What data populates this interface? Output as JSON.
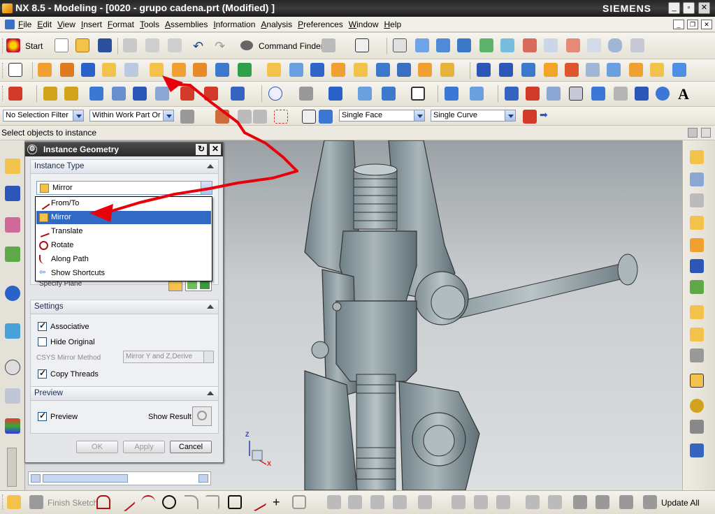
{
  "window": {
    "title": "NX 8.5 - Modeling - [0020 - grupo cadena.prt (Modified) ]",
    "brand": "SIEMENS",
    "controls": [
      "_",
      "▫",
      "✕"
    ]
  },
  "menu": [
    "File",
    "Edit",
    "View",
    "Insert",
    "Format",
    "Tools",
    "Assemblies",
    "Information",
    "Analysis",
    "Preferences",
    "Window",
    "Help"
  ],
  "toolbar1": {
    "start_label": "Start",
    "command_finder_label": "Command Finder"
  },
  "selection_bar": {
    "filter": "No Selection Filter",
    "scope": "Within Work Part Or",
    "face_rule": "Single Face",
    "curve_rule": "Single Curve"
  },
  "status_text": "Select objects to instance",
  "dialog": {
    "title": "Instance Geometry",
    "instance_type_header": "Instance Type",
    "instance_type_value": "Mirror",
    "dropdown_options": [
      {
        "label": "From/To",
        "icon": "from-to-icon"
      },
      {
        "label": "Mirror",
        "icon": "mirror-icon",
        "selected": true
      },
      {
        "label": "Translate",
        "icon": "translate-icon"
      },
      {
        "label": "Rotate",
        "icon": "rotate-icon"
      },
      {
        "label": "Along Path",
        "icon": "along-path-icon"
      },
      {
        "label": "Show Shortcuts",
        "icon": "shortcuts-icon"
      }
    ],
    "specify_plane_label": "Specify Plane",
    "settings_header": "Settings",
    "associative_label": "Associative",
    "associative_checked": true,
    "hide_original_label": "Hide Original",
    "hide_original_checked": false,
    "csys_label": "CSYS Mirror Method",
    "csys_value": "Mirror Y and Z,Derive",
    "copy_threads_label": "Copy Threads",
    "copy_threads_checked": true,
    "preview_header": "Preview",
    "preview_label": "Preview",
    "preview_checked": true,
    "show_result_label": "Show Result",
    "ok_label": "OK",
    "apply_label": "Apply",
    "cancel_label": "Cancel"
  },
  "bottom_toolbar": {
    "finish_sketch_label": "Finish Sketch",
    "update_all_label": "Update All"
  },
  "triad": {
    "z": "Z",
    "x": "X"
  },
  "colors": {
    "accent_select": "#316ac5",
    "annotation_red": "#e8000a",
    "model_gray": "#8f9ea3"
  }
}
